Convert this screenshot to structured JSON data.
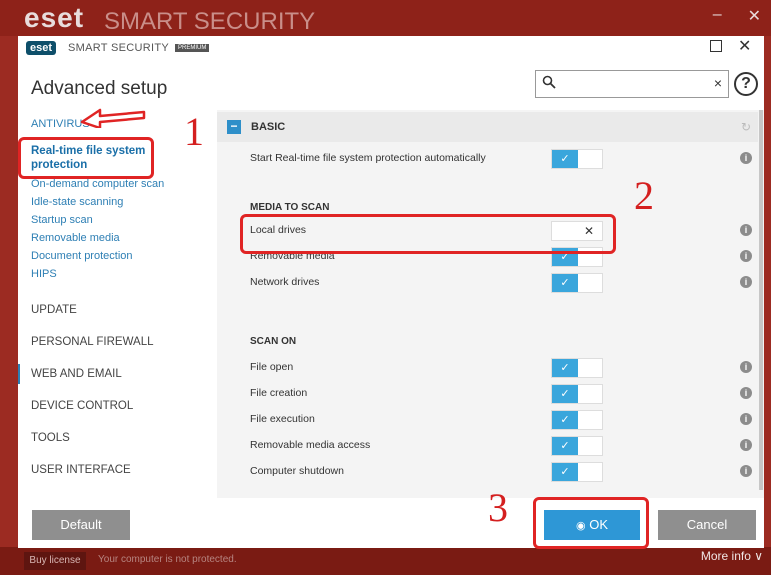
{
  "background": {
    "logo": "eset",
    "logo_text": "SMART SECURITY",
    "premium_badge": "PREMIUM",
    "minimize_glyph": "–",
    "close_glyph": "✕",
    "buy_license": "Buy license",
    "status_text": "Your computer is not protected.",
    "more_info": "More info ∨"
  },
  "dialog": {
    "logo": "eset",
    "logo_text": "SMART SECURITY",
    "premium_badge": "PREMIUM",
    "close_glyph": "✕",
    "title": "Advanced setup",
    "search": {
      "value": "",
      "icon": "search-icon",
      "clear_glyph": "×"
    },
    "help_glyph": "?"
  },
  "sidebar": {
    "antivirus": "ANTIVIRUS",
    "active": "Real-time file system protection",
    "items": [
      "On-demand computer scan",
      "Idle-state scanning",
      "Startup scan",
      "Removable media",
      "Document protection",
      "HIPS"
    ],
    "sections": [
      "UPDATE",
      "PERSONAL FIREWALL",
      "WEB AND EMAIL",
      "DEVICE CONTROL",
      "TOOLS",
      "USER INTERFACE"
    ]
  },
  "content": {
    "section_title": "BASIC",
    "collapse_glyph": "−",
    "revert_glyph": "↻",
    "basic_row": {
      "label": "Start Real-time file system protection automatically",
      "on": true
    },
    "media_title": "MEDIA TO SCAN",
    "media_rows": [
      {
        "label": "Local drives",
        "on": false
      },
      {
        "label": "Removable media",
        "on": true
      },
      {
        "label": "Network drives",
        "on": true
      }
    ],
    "scanon_title": "SCAN ON",
    "scanon_rows": [
      {
        "label": "File open",
        "on": true
      },
      {
        "label": "File creation",
        "on": true
      },
      {
        "label": "File execution",
        "on": true
      },
      {
        "label": "Removable media access",
        "on": true
      },
      {
        "label": "Computer shutdown",
        "on": true
      }
    ],
    "check_glyph": "✓",
    "cross_glyph": "✕",
    "info_glyph": "i"
  },
  "footer": {
    "default_label": "Default",
    "ok_label": "OK",
    "ok_icon_glyph": "◉",
    "cancel_label": "Cancel"
  },
  "annotations": [
    "1",
    "2",
    "3"
  ],
  "colors": {
    "accent": "#2e97d6",
    "annotation": "#e02424",
    "background_app": "#9c2b22"
  }
}
